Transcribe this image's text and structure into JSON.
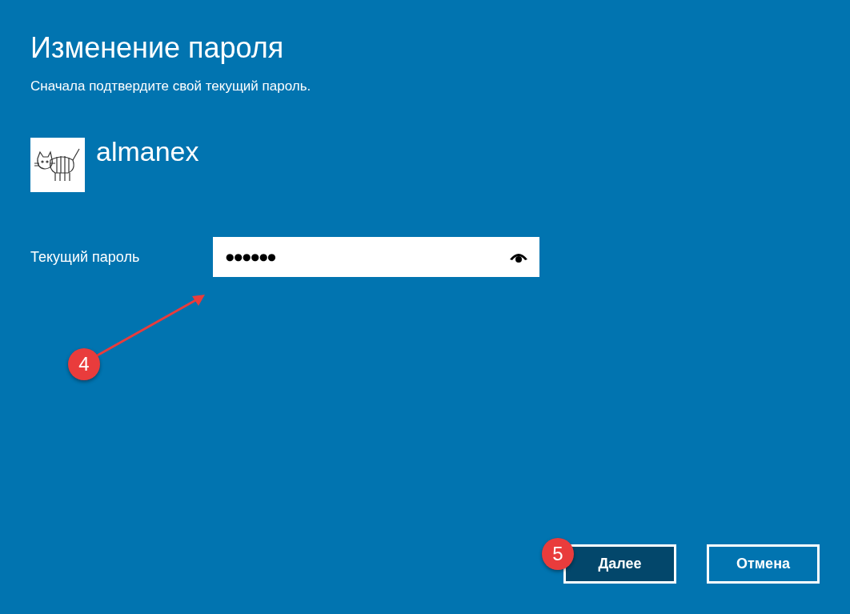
{
  "dialog": {
    "title": "Изменение пароля",
    "subtitle": "Сначала подтвердите свой текущий пароль.",
    "user": {
      "name": "almanex"
    },
    "password_field": {
      "label": "Текущий пароль",
      "value": "●●●●●●"
    },
    "buttons": [
      {
        "label": "Далее",
        "primary": true
      },
      {
        "label": "Отмена",
        "primary": false
      }
    ]
  },
  "annotations": [
    {
      "label": "4",
      "kind": "arrow"
    },
    {
      "label": "5",
      "kind": "badge"
    }
  ]
}
